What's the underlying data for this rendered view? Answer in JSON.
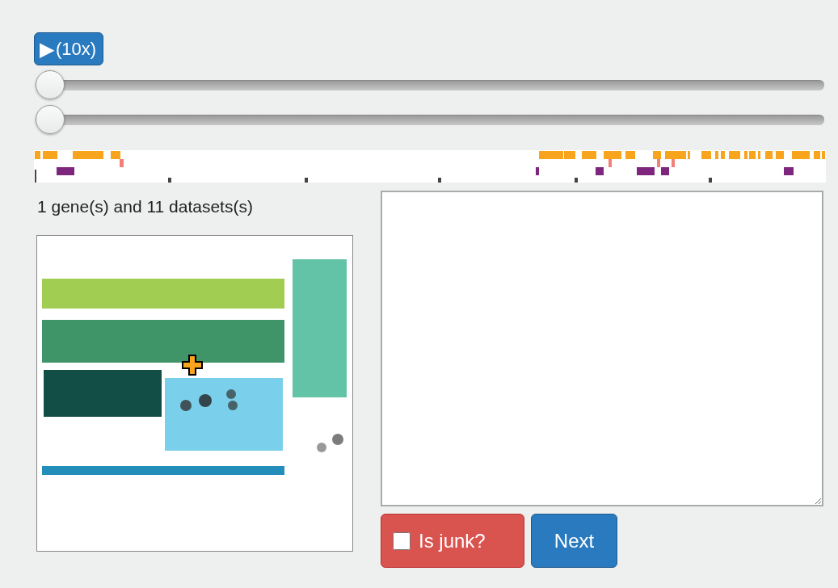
{
  "play_button": {
    "icon": "▶",
    "label": "(10x)"
  },
  "sliders": [
    {
      "level": 0
    },
    {
      "level": 0
    }
  ],
  "summary": "1 gene(s) and 11 datasets(s)",
  "junk_checkbox": {
    "label": "Is junk?",
    "checked": false
  },
  "next_button": {
    "label": "Next"
  }
}
